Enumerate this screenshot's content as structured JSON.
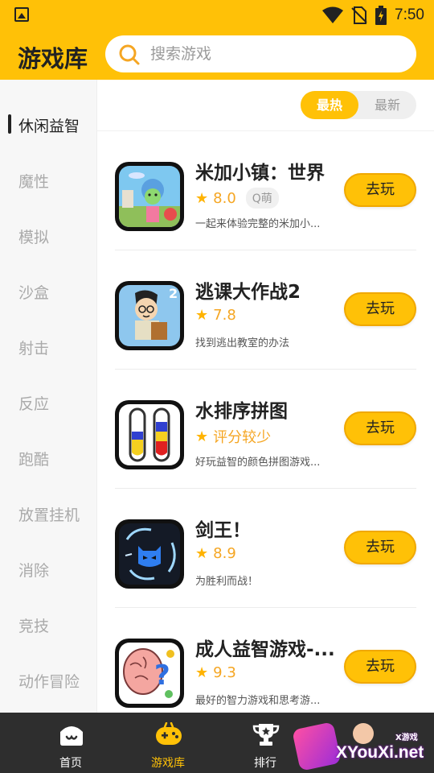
{
  "status_bar": {
    "time": "7:50"
  },
  "header": {
    "title": "游戏库"
  },
  "search": {
    "placeholder": "搜索游戏"
  },
  "sidebar": {
    "items": [
      {
        "label": "休闲益智",
        "active": true
      },
      {
        "label": "魔性",
        "active": false
      },
      {
        "label": "模拟",
        "active": false
      },
      {
        "label": "沙盒",
        "active": false
      },
      {
        "label": "射击",
        "active": false
      },
      {
        "label": "反应",
        "active": false
      },
      {
        "label": "跑酷",
        "active": false
      },
      {
        "label": "放置挂机",
        "active": false
      },
      {
        "label": "消除",
        "active": false
      },
      {
        "label": "竞技",
        "active": false
      },
      {
        "label": "动作冒险",
        "active": false
      }
    ]
  },
  "sort": {
    "hot": "最热",
    "new": "最新",
    "selected": "hot"
  },
  "games": [
    {
      "title": "米加小镇：世界",
      "score": "8.0",
      "tag": "Q萌",
      "desc": "一起来体验完整的米加小...",
      "button": "去玩",
      "icon": "toca-world-icon"
    },
    {
      "title": "逃课大作战2",
      "score": "7.8",
      "tag": "",
      "desc": "找到逃出教室的办法",
      "button": "去玩",
      "icon": "escape-class-icon"
    },
    {
      "title": "水排序拼图",
      "score": "评分较少",
      "tag": "",
      "desc": "好玩益智的颜色拼图游戏...",
      "button": "去玩",
      "icon": "water-sort-icon"
    },
    {
      "title": "剑王！",
      "score": "8.9",
      "tag": "",
      "desc": "为胜利而战！",
      "button": "去玩",
      "icon": "sword-king-icon"
    },
    {
      "title": "成人益智游戏-...",
      "score": "9.3",
      "tag": "",
      "desc": "最好的智力游戏和思考游...",
      "button": "去玩",
      "icon": "brain-puzzle-icon"
    }
  ],
  "tabbar": {
    "items": [
      {
        "label": "首页",
        "icon": "home-icon",
        "active": false
      },
      {
        "label": "游戏库",
        "icon": "gamepad-icon",
        "active": true
      },
      {
        "label": "排行",
        "icon": "trophy-icon",
        "active": false
      },
      {
        "label": "",
        "icon": "profile-icon",
        "active": false
      }
    ]
  },
  "watermark": {
    "text": "XYouXi.net",
    "small": "X游戏"
  },
  "colors": {
    "accent": "#ffc107",
    "tabbar": "#2e2e2e",
    "score": "#f5a623"
  }
}
